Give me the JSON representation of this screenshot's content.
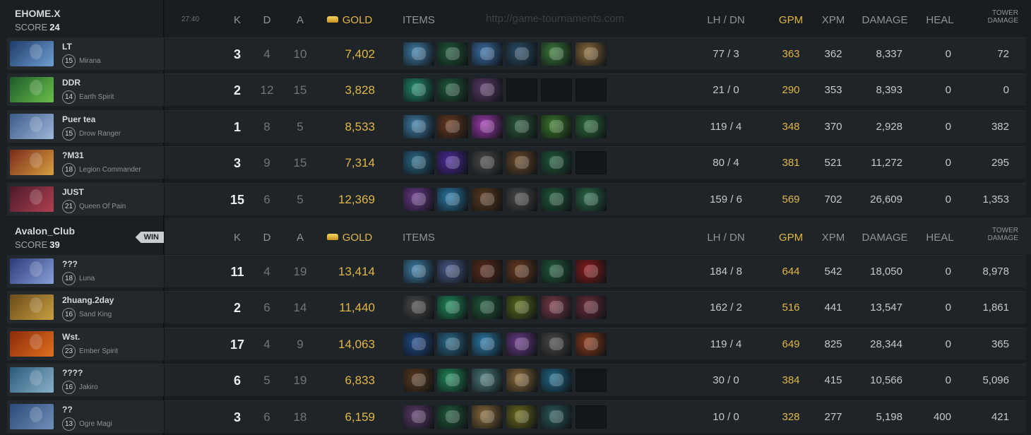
{
  "timer": "27:40",
  "watermark": "http://game-tournaments.com",
  "logo_text": "GT",
  "headers": {
    "k": "K",
    "d": "D",
    "a": "A",
    "gold": "GOLD",
    "items": "ITEMS",
    "lhdn": "LH / DN",
    "gpm": "GPM",
    "xpm": "XPM",
    "damage": "DAMAGE",
    "heal": "HEAL",
    "tower1": "TOWER",
    "tower2": "DAMAGE"
  },
  "colors": {
    "gold": "#e1b744",
    "row_bg": "#1f2428",
    "sidebar_bg": "#1a1f23"
  },
  "teams": [
    {
      "name": "EHOME.X",
      "score_label": "SCORE",
      "score": "24",
      "win_label": "",
      "players": [
        {
          "name": "LT",
          "level": "15",
          "hero": "Mirana",
          "k": "3",
          "d": "4",
          "a": "10",
          "gold": "7,402",
          "lhdn": "77 / 3",
          "gpm": "363",
          "xpm": "362",
          "damage": "8,337",
          "heal": "0",
          "tower": "72",
          "portrait": [
            "#1d3a6b",
            "#6fa0d0"
          ],
          "items": [
            "#3f7fa8",
            "#1f5a3a",
            "#3a6fa8",
            "#2a4f6a",
            "#3a7a3a",
            "#8a6a3a"
          ]
        },
        {
          "name": "DDR",
          "level": "14",
          "hero": "Earth Spirit",
          "k": "2",
          "d": "12",
          "a": "15",
          "gold": "3,828",
          "lhdn": "21 / 0",
          "gpm": "290",
          "xpm": "353",
          "damage": "8,393",
          "heal": "0",
          "tower": "0",
          "portrait": [
            "#1d5a2a",
            "#6ac04a"
          ],
          "items": [
            "#1f8a6a",
            "#1f5a3a",
            "#5a3a6a",
            "",
            "",
            ""
          ]
        },
        {
          "name": "Puer tea",
          "level": "15",
          "hero": "Drow Ranger",
          "k": "1",
          "d": "8",
          "a": "5",
          "gold": "8,533",
          "lhdn": "119 / 4",
          "gpm": "348",
          "xpm": "370",
          "damage": "2,928",
          "heal": "0",
          "tower": "382",
          "portrait": [
            "#3a5a8a",
            "#a0b8d8"
          ],
          "items": [
            "#3f7fa8",
            "#6a3a1f",
            "#a03ab0",
            "#2a5a3a",
            "#3a7a2a",
            "#2a6a3a"
          ]
        },
        {
          "name": "?M31",
          "level": "18",
          "hero": "Legion Commander",
          "k": "3",
          "d": "9",
          "a": "15",
          "gold": "7,314",
          "lhdn": "80 / 4",
          "gpm": "381",
          "xpm": "521",
          "damage": "11,272",
          "heal": "0",
          "tower": "295",
          "portrait": [
            "#7a2a1a",
            "#d8a040"
          ],
          "items": [
            "#2a6a8a",
            "#4a2a9a",
            "#4a4a4a",
            "#6a4a2a",
            "#1f5a3a",
            ""
          ]
        },
        {
          "name": "JUST",
          "level": "21",
          "hero": "Queen Of Pain",
          "k": "15",
          "d": "6",
          "a": "5",
          "gold": "12,369",
          "lhdn": "159 / 6",
          "gpm": "569",
          "xpm": "702",
          "damage": "26,609",
          "heal": "0",
          "tower": "1,353",
          "portrait": [
            "#4a1a2a",
            "#b04050"
          ],
          "items": [
            "#6a3a8a",
            "#2a7aa8",
            "#5a3a1f",
            "#4a4a4a",
            "#1f5a3a",
            "#2a6a4a"
          ]
        }
      ]
    },
    {
      "name": "Avalon_Club",
      "score_label": "SCORE",
      "score": "39",
      "win_label": "WIN",
      "players": [
        {
          "name": "???",
          "level": "18",
          "hero": "Luna",
          "k": "11",
          "d": "4",
          "a": "19",
          "gold": "13,414",
          "lhdn": "184 / 8",
          "gpm": "644",
          "xpm": "542",
          "damage": "18,050",
          "heal": "0",
          "tower": "8,978",
          "portrait": [
            "#2a3a7a",
            "#8aa0d8"
          ],
          "items": [
            "#3f7fa8",
            "#4a5a8a",
            "#5a2a1a",
            "#6a3a1f",
            "#1f5a3a",
            "#8a1a1a"
          ]
        },
        {
          "name": "2huang.2day",
          "level": "16",
          "hero": "Sand King",
          "k": "2",
          "d": "6",
          "a": "14",
          "gold": "11,440",
          "lhdn": "162 / 2",
          "gpm": "516",
          "xpm": "441",
          "damage": "13,547",
          "heal": "0",
          "tower": "1,861",
          "portrait": [
            "#6a4a1a",
            "#c8a040"
          ],
          "items": [
            "#4a4a4a",
            "#1f8a5a",
            "#1f5a3a",
            "#5a6a1a",
            "#7a3a4a",
            "#6a2a3a"
          ]
        },
        {
          "name": "Wst.",
          "level": "23",
          "hero": "Ember Spirit",
          "k": "17",
          "d": "4",
          "a": "9",
          "gold": "14,063",
          "lhdn": "119 / 4",
          "gpm": "649",
          "xpm": "825",
          "damage": "28,344",
          "heal": "0",
          "tower": "365",
          "portrait": [
            "#8a2a0a",
            "#e07020"
          ],
          "items": [
            "#1f4a8a",
            "#2a6a8a",
            "#2a7aa8",
            "#6a3a8a",
            "#4a4a4a",
            "#8a3a1a"
          ]
        },
        {
          "name": "????",
          "level": "16",
          "hero": "Jakiro",
          "k": "6",
          "d": "5",
          "a": "19",
          "gold": "6,833",
          "lhdn": "30 / 0",
          "gpm": "384",
          "xpm": "415",
          "damage": "10,566",
          "heal": "0",
          "tower": "5,096",
          "portrait": [
            "#2a5a7a",
            "#8ab0c8"
          ],
          "items": [
            "#5a3a1f",
            "#1f8a5a",
            "#4a7a7a",
            "#8a6a3a",
            "#1f6a8a",
            ""
          ]
        },
        {
          "name": "??",
          "level": "13",
          "hero": "Ogre Magi",
          "k": "3",
          "d": "6",
          "a": "18",
          "gold": "6,159",
          "lhdn": "10 / 0",
          "gpm": "328",
          "xpm": "277",
          "damage": "5,198",
          "heal": "400",
          "tower": "421",
          "portrait": [
            "#2a4a7a",
            "#7090b8"
          ],
          "items": [
            "#5a3a6a",
            "#1f5a3a",
            "#8a6a3a",
            "#6a6a1a",
            "#2a5a5a",
            ""
          ]
        }
      ]
    }
  ]
}
